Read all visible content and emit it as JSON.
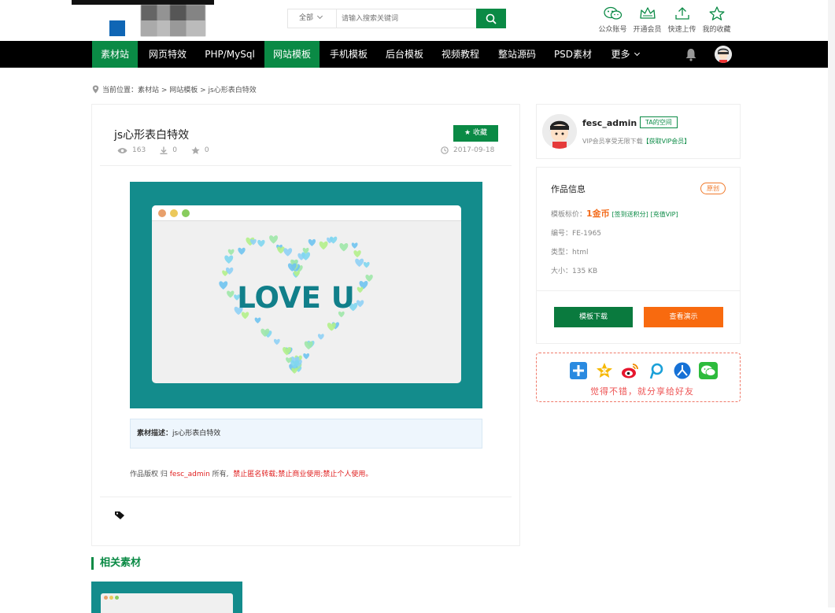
{
  "header": {
    "search": {
      "scope": "全部",
      "placeholder": "请输入搜索关键词"
    },
    "icons": [
      {
        "label": "公众账号",
        "icon": "wechat-icon"
      },
      {
        "label": "开通会员",
        "icon": "crown-icon"
      },
      {
        "label": "快速上传",
        "icon": "upload-icon"
      },
      {
        "label": "我的收藏",
        "icon": "star-icon"
      }
    ]
  },
  "nav": {
    "items": [
      "素材站",
      "网页特效",
      "PHP/MySql",
      "网站模板",
      "手机模板",
      "后台模板",
      "视频教程",
      "整站源码",
      "PSD素材",
      "更多"
    ]
  },
  "breadcrumb": {
    "prefix": "当前位置：",
    "path": "素材站 > 网站模板 > js心形表白特效"
  },
  "article": {
    "title": "js心形表白特效",
    "fav_label": "收藏",
    "views": "163",
    "downloads": "0",
    "stars": "0",
    "date": "2017-09-18",
    "preview_text": "LOVE U",
    "desc_label": "素材描述：",
    "desc_value": "js心形表白特效",
    "copyright_prefix": "作品版权 归",
    "copyright_owner": "fesc_admin",
    "copyright_mid": "所有,",
    "copyright_warn": "禁止匿名转载;禁止商业使用;禁止个人使用。"
  },
  "related": {
    "title": "相关素材"
  },
  "author": {
    "name": "fesc_admin",
    "space_label": "TA的空间",
    "vip_text": "VIP会员享受无限下载",
    "vip_link": "【获取VIP会员】"
  },
  "info": {
    "heading": "作品信息",
    "original_badge": "原创",
    "price_label": "模板标价：",
    "price_value": "1金币",
    "price_link1": "[签到送积分]",
    "price_link2": "[充值VIP]",
    "id_label": "编号：",
    "id_value": "FE-1965",
    "type_label": "类型：",
    "type_value": "html",
    "size_label": "大小：",
    "size_value": "135 KB",
    "download_label": "模板下载",
    "demo_label": "查看演示"
  },
  "share": {
    "text": "觉得不错，就分享给好友"
  },
  "colors": {
    "brand_green": "#0a8a45",
    "orange": "#f86a0f",
    "preview_teal": "#138c8c"
  }
}
